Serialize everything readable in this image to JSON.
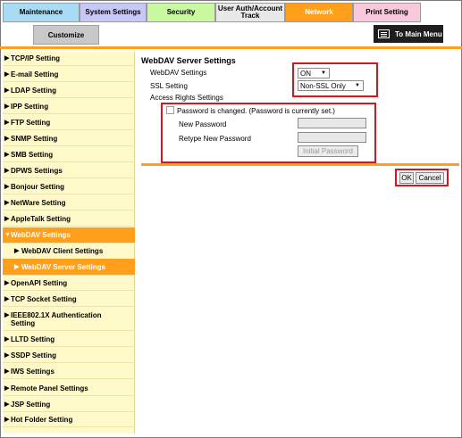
{
  "tabs": [
    {
      "label": "Maintenance",
      "color": "#a8dcf4"
    },
    {
      "label": "System Settings",
      "color": "#c8c8f8"
    },
    {
      "label": "Security",
      "color": "#c8f8a0"
    },
    {
      "label": "User Auth/Account Track",
      "color": "#e8e8e8"
    },
    {
      "label": "Network",
      "color": "#ff9f1c"
    },
    {
      "label": "Print Setting",
      "color": "#f8c8dc"
    }
  ],
  "subtab": {
    "label": "Customize"
  },
  "to_main_menu": {
    "label": "To Main Menu",
    "icon": "main-menu-icon"
  },
  "sidebar": {
    "items": [
      {
        "label": "TCP/IP Setting"
      },
      {
        "label": "E-mail Setting"
      },
      {
        "label": "LDAP Setting"
      },
      {
        "label": "IPP Setting"
      },
      {
        "label": "FTP Setting"
      },
      {
        "label": "SNMP Setting"
      },
      {
        "label": "SMB Setting"
      },
      {
        "label": "DPWS Settings"
      },
      {
        "label": "Bonjour Setting"
      },
      {
        "label": "NetWare Setting"
      },
      {
        "label": "AppleTalk Setting"
      },
      {
        "label": "WebDAV Settings"
      },
      {
        "label": "WebDAV Client Settings"
      },
      {
        "label": "WebDAV Server Settings"
      },
      {
        "label": "OpenAPI Setting"
      },
      {
        "label": "TCP Socket Setting"
      },
      {
        "label": "IEEE802.1X Authentication Setting"
      },
      {
        "label": "LLTD Setting"
      },
      {
        "label": "SSDP Setting"
      },
      {
        "label": "IWS Settings"
      },
      {
        "label": "Remote Panel Settings"
      },
      {
        "label": "JSP Setting"
      },
      {
        "label": "Hot Folder Setting"
      }
    ]
  },
  "main": {
    "title": "WebDAV Server Settings",
    "webdav_settings_label": "WebDAV Settings",
    "webdav_settings_value": "ON",
    "ssl_setting_label": "SSL Setting",
    "ssl_setting_value": "Non-SSL Only",
    "access_rights_label": "Access Rights Settings",
    "password_changed_label": "Password is changed. (Password is currently set.)",
    "new_password_label": "New Password",
    "retype_password_label": "Retype New Password",
    "initial_password_label": "Initial Password",
    "ok_label": "OK",
    "cancel_label": "Cancel"
  },
  "colors": {
    "accent": "#ff9f1c",
    "sidebar_bg": "#fff8c8",
    "highlight": "#d8141c"
  }
}
